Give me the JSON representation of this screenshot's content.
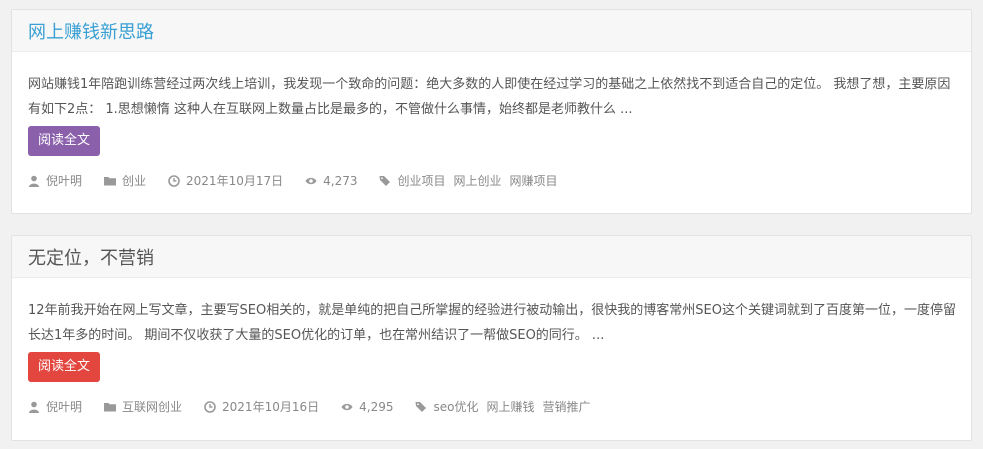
{
  "posts": [
    {
      "title": "网上赚钱新思路",
      "excerpt": "网站赚钱1年陪跑训练营经过两次线上培训，我发现一个致命的问题：绝大多数的人即使在经过学习的基础之上依然找不到适合自己的定位。 我想了想，主要原因有如下2点： 1.思想懒惰 这种人在互联网上数量占比是最多的，不管做什么事情，始终都是老师教什么 ...",
      "button_label": "阅读全文",
      "author": "倪叶明",
      "category": "创业",
      "date": "2021年10月17日",
      "views": "4,273",
      "tags": [
        "创业项目",
        "网上创业",
        "网赚项目"
      ]
    },
    {
      "title": "无定位，不营销",
      "excerpt": "12年前我开始在网上写文章，主要写SEO相关的，就是单纯的把自己所掌握的经验进行被动输出，很快我的博客常州SEO这个关键词就到了百度第一位，一度停留长达1年多的时间。 期间不仅收获了大量的SEO优化的订单，也在常州结识了一帮做SEO的同行。 ...",
      "button_label": "阅读全文",
      "author": "倪叶明",
      "category": "互联网创业",
      "date": "2021年10月16日",
      "views": "4,295",
      "tags": [
        "seo优化",
        "网上赚钱",
        "营销推广"
      ]
    }
  ],
  "colors": {
    "title_link": "#3aa0d3",
    "button_purple": "#8a60ab",
    "button_red": "#e2463f"
  },
  "icons": [
    "user-icon",
    "folder-icon",
    "clock-icon",
    "eye-icon",
    "tag-icon"
  ]
}
